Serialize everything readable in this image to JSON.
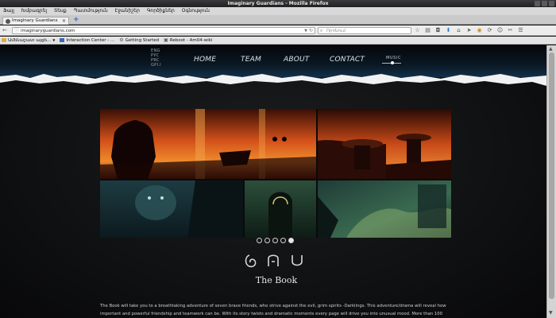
{
  "window": {
    "title": "Imaginary Guardians - Mozilla Firefox"
  },
  "menubar": [
    "Ֆայլ",
    "Խմբագրել",
    "Տեսք",
    "Պատմություն",
    "Էջանիշեր",
    "Գործիքներ",
    "Օգնություն"
  ],
  "tab": {
    "title": "Imaginary Guardians",
    "close": "✕"
  },
  "newtab": "+",
  "nav": {
    "back": "←",
    "forward": "→",
    "url": "imaginaryguardians.com",
    "search_placeholder": "Որոնում"
  },
  "bookmarks": [
    {
      "label": "Ամենաշատ այցե...",
      "icon": "folder-icon"
    },
    {
      "label": "Interaction Center - ...",
      "icon": "page-icon"
    },
    {
      "label": "Getting Started",
      "icon": "gear-icon"
    },
    {
      "label": "Reboot - Am04-wiki",
      "icon": "page-icon"
    }
  ],
  "site": {
    "languages": [
      "ENG",
      "РУС",
      "PRC",
      "GPI.I"
    ],
    "nav": [
      "HOME",
      "TEAM",
      "ABOUT",
      "CONTACT"
    ],
    "music_label": "MUSIC",
    "music_level": 0.55,
    "slider": {
      "count": 5,
      "active_index": 4
    },
    "section_title": "The Book",
    "description": "The Book will take you to a breathtaking adventure of seven brave friends, who strive against the evil, grim spirits -Darklings. This adventure/drama will reveal how important and powerful friendship and teamwork can be. With its story twists and dramatic moments every page will drive you into unusual mood. More than 100 illustrations will guide"
  },
  "colors": {
    "accent_orange": "#e8641b",
    "page_bg": "#101112",
    "firefox_blue": "#2a6fd1"
  }
}
